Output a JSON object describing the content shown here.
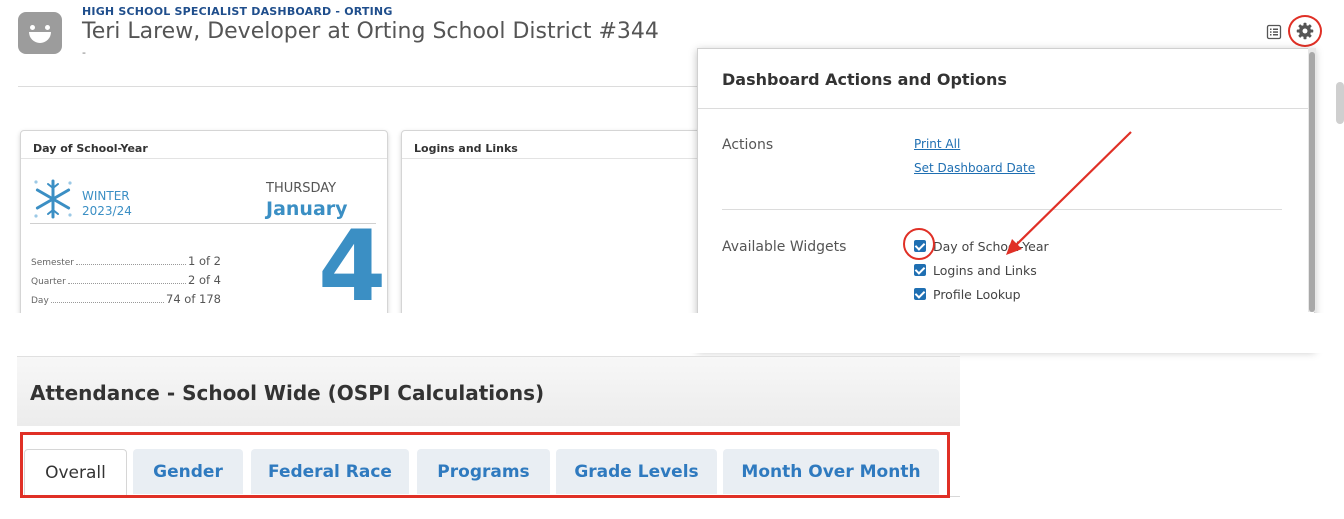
{
  "header": {
    "dashboard_title": "HIGH SCHOOL SPECIALIST DASHBOARD - ORTING",
    "user_line": "Teri Larew, Developer at Orting School District #344",
    "sub_dash": "-"
  },
  "widgets": {
    "day_of_school_year": {
      "title": "Day of School-Year",
      "season": "WINTER",
      "season_year": "2023/24",
      "weekday": "THURSDAY",
      "month": "January",
      "day": "4",
      "stats": [
        {
          "label": "Semester",
          "value": "1 of 2"
        },
        {
          "label": "Quarter",
          "value": "2 of 4"
        },
        {
          "label": "Day",
          "value": "74 of 178"
        }
      ]
    },
    "logins_and_links": {
      "title": "Logins and Links"
    }
  },
  "options_panel": {
    "title": "Dashboard Actions and Options",
    "actions_label": "Actions",
    "actions": [
      "Print All",
      "Set Dashboard Date"
    ],
    "available_widgets_label": "Available Widgets",
    "available_widgets": [
      {
        "label": "Day of School-Year",
        "checked": true
      },
      {
        "label": "Logins and Links",
        "checked": true
      },
      {
        "label": "Profile Lookup",
        "checked": true
      }
    ]
  },
  "attendance": {
    "title": "Attendance - School Wide (OSPI Calculations)",
    "tabs": [
      "Overall",
      "Gender",
      "Federal Race",
      "Programs",
      "Grade Levels",
      "Month Over Month"
    ],
    "active_tab": "Overall"
  },
  "colors": {
    "accent_blue": "#3b8fc4",
    "link_blue": "#1f6fb2",
    "annotation_red": "#e03026"
  },
  "icons": {
    "avatar": "smiley-avatar-icon",
    "list": "list-icon",
    "settings": "gear-icon",
    "season": "snowflake-icon"
  }
}
